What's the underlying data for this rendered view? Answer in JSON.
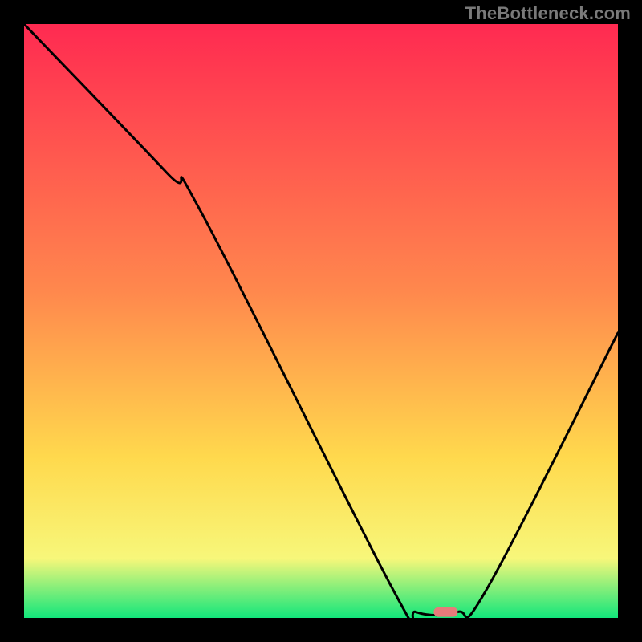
{
  "watermark": "TheBottleneck.com",
  "chart_data": {
    "type": "line",
    "title": "",
    "xlabel": "",
    "ylabel": "",
    "xlim": [
      0,
      100
    ],
    "ylim": [
      0,
      100
    ],
    "grid": false,
    "curve_points": [
      {
        "x": 0,
        "y": 100
      },
      {
        "x": 24,
        "y": 75
      },
      {
        "x": 30,
        "y": 68
      },
      {
        "x": 62,
        "y": 5
      },
      {
        "x": 66,
        "y": 1
      },
      {
        "x": 73,
        "y": 1
      },
      {
        "x": 78,
        "y": 5
      },
      {
        "x": 100,
        "y": 48
      }
    ],
    "marker": {
      "x": 71,
      "y": 1
    },
    "gradient_colors": {
      "top": "#ff2a51",
      "mid1": "#ff884d",
      "mid2": "#ffd94d",
      "mid3": "#f7f77a",
      "bottom": "#12e67b"
    }
  }
}
